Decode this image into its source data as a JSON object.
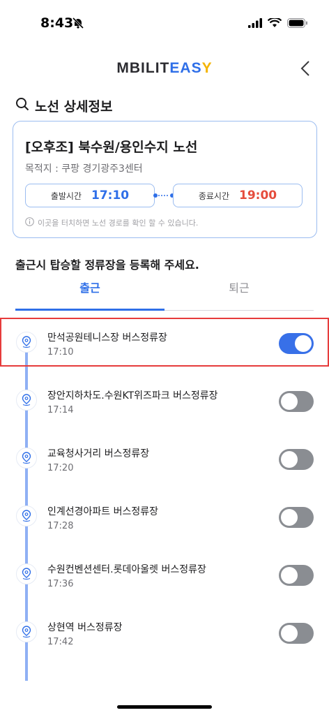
{
  "status_bar": {
    "time": "8:43"
  },
  "header": {
    "logo_m": "M",
    "logo_bilit": "BILIT",
    "logo_eas": "EAS",
    "logo_y": "Y"
  },
  "section": {
    "title": "노선 상세정보"
  },
  "route": {
    "name": "[오후조] 북수원/용인수지 노선",
    "destination": "목적지 : 쿠팡 경기광주3센터",
    "start_label": "출발시간",
    "start_time": "17:10",
    "end_label": "종료시간",
    "end_time": "19:00",
    "note": "이곳을 터치하면 노선 경로를 확인 할 수 있습니다."
  },
  "prompt": "출근시 탑승할 정류장을 등록해 주세요.",
  "tabs": [
    {
      "label": "출근"
    },
    {
      "label": "퇴근"
    }
  ],
  "stops": [
    {
      "name": "만석공원테니스장 버스정류장",
      "time": "17:10",
      "enabled": true
    },
    {
      "name": "장안지하차도.수원KT위즈파크 버스정류장",
      "time": "17:14",
      "enabled": false
    },
    {
      "name": "교육청사거리 버스정류장",
      "time": "17:20",
      "enabled": false
    },
    {
      "name": "인계선경아파트 버스정류장",
      "time": "17:28",
      "enabled": false
    },
    {
      "name": "수원컨벤션센터.롯데아울렛 버스정류장",
      "time": "17:36",
      "enabled": false
    },
    {
      "name": "상현역 버스정류장",
      "time": "17:42",
      "enabled": false
    }
  ],
  "colors": {
    "accent": "#2f6fe8",
    "end_time": "#e54c3c",
    "toggle_off": "#8a8d92",
    "highlight": "#e63b3b"
  }
}
